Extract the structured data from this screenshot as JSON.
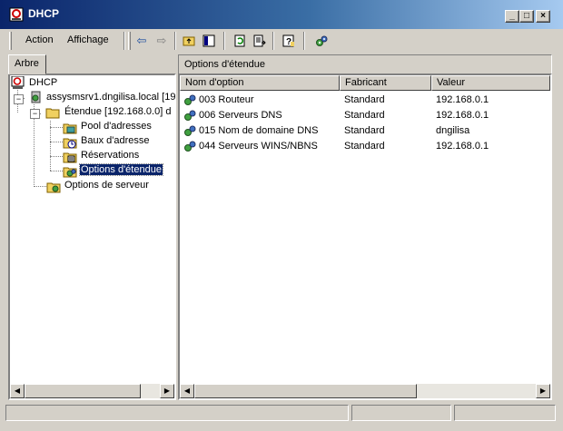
{
  "window": {
    "title": "DHCP"
  },
  "caption_buttons": {
    "minimize": "_",
    "maximize": "□",
    "close": "×"
  },
  "menu": {
    "action": "Action",
    "view": "Affichage"
  },
  "tree": {
    "tab_label": "Arbre",
    "items": [
      {
        "label": "DHCP"
      },
      {
        "label": "assysmsrv1.dngilisa.local [19"
      },
      {
        "label": "Étendue [192.168.0.0] d"
      },
      {
        "label": "Pool d'adresses"
      },
      {
        "label": "Baux d'adresse"
      },
      {
        "label": "Réservations"
      },
      {
        "label": "Options d'étendue"
      },
      {
        "label": "Options de serveur"
      }
    ]
  },
  "list": {
    "title": "Options d'étendue",
    "columns": [
      "Nom d'option",
      "Fabricant",
      "Valeur"
    ],
    "rows": [
      {
        "name": "003 Routeur",
        "vendor": "Standard",
        "value": "192.168.0.1"
      },
      {
        "name": "006 Serveurs DNS",
        "vendor": "Standard",
        "value": "192.168.0.1"
      },
      {
        "name": "015 Nom de domaine DNS",
        "vendor": "Standard",
        "value": "dngilisa"
      },
      {
        "name": "044 Serveurs WINS/NBNS",
        "vendor": "Standard",
        "value": "192.168.0.1"
      }
    ]
  },
  "colors": {
    "titlebar_start": "#0a246a",
    "titlebar_end": "#a6caf0",
    "selection": "#0a246a",
    "face": "#d4d0c8"
  }
}
